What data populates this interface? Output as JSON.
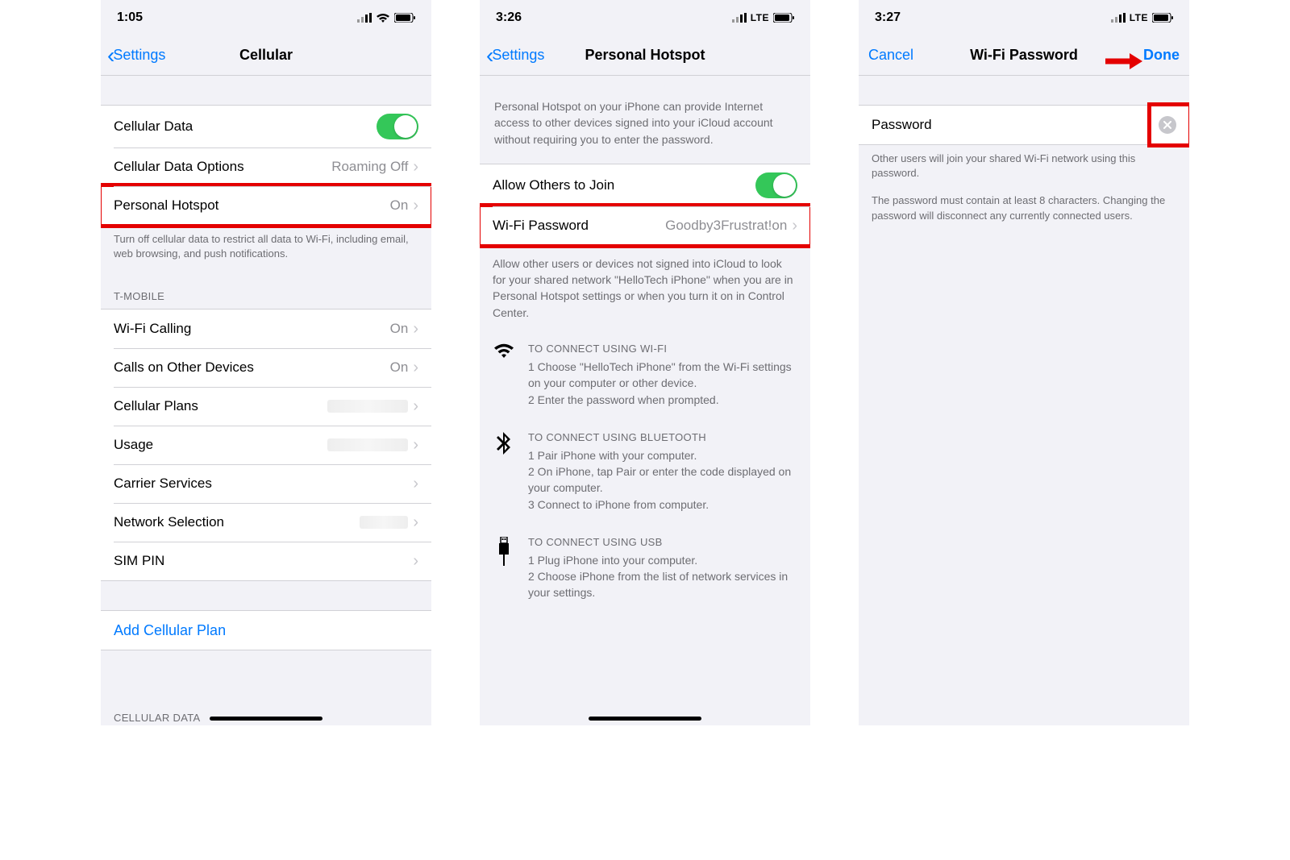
{
  "screen1": {
    "time": "1:05",
    "nav_back": "Settings",
    "title": "Cellular",
    "rows": {
      "cellular_data": "Cellular Data",
      "cellular_data_options": "Cellular Data Options",
      "cellular_data_options_value": "Roaming Off",
      "personal_hotspot": "Personal Hotspot",
      "personal_hotspot_value": "On",
      "footer1": "Turn off cellular data to restrict all data to Wi-Fi, including email, web browsing, and push notifications.",
      "carrier_header": "T-MOBILE",
      "wifi_calling": "Wi-Fi Calling",
      "wifi_calling_value": "On",
      "calls_other": "Calls on Other Devices",
      "calls_other_value": "On",
      "cellular_plans": "Cellular Plans",
      "usage": "Usage",
      "carrier_services": "Carrier Services",
      "network_selection": "Network Selection",
      "sim_pin": "SIM PIN",
      "add_plan": "Add Cellular Plan",
      "cellular_data_header": "CELLULAR DATA"
    }
  },
  "screen2": {
    "time": "3:26",
    "signal_label": "LTE",
    "nav_back": "Settings",
    "title": "Personal Hotspot",
    "intro": "Personal Hotspot on your iPhone can provide Internet access to other devices signed into your iCloud account without requiring you to enter the password.",
    "allow_join": "Allow Others to Join",
    "wifi_password_label": "Wi-Fi Password",
    "wifi_password_value": "Goodby3Frustrat!on",
    "allow_footer": "Allow other users or devices not signed into iCloud to look for your shared network \"HelloTech iPhone\" when you are in Personal Hotspot settings or when you turn it on in Control Center.",
    "wifi_title": "TO CONNECT USING WI-FI",
    "wifi_step1": "1 Choose \"HelloTech iPhone\" from the Wi-Fi settings on your computer or other device.",
    "wifi_step2": "2 Enter the password when prompted.",
    "bt_title": "TO CONNECT USING BLUETOOTH",
    "bt_step1": "1 Pair iPhone with your computer.",
    "bt_step2": "2 On iPhone, tap Pair or enter the code displayed on your computer.",
    "bt_step3": "3 Connect to iPhone from computer.",
    "usb_title": "TO CONNECT USING USB",
    "usb_step1": "1 Plug iPhone into your computer.",
    "usb_step2": "2 Choose iPhone from the list of network services in your settings."
  },
  "screen3": {
    "time": "3:27",
    "signal_label": "LTE",
    "cancel": "Cancel",
    "title": "Wi-Fi Password",
    "done": "Done",
    "password_label": "Password",
    "footer1": "Other users will join your shared Wi-Fi network using this password.",
    "footer2": "The password must contain at least 8 characters. Changing the password will disconnect any currently connected users."
  }
}
